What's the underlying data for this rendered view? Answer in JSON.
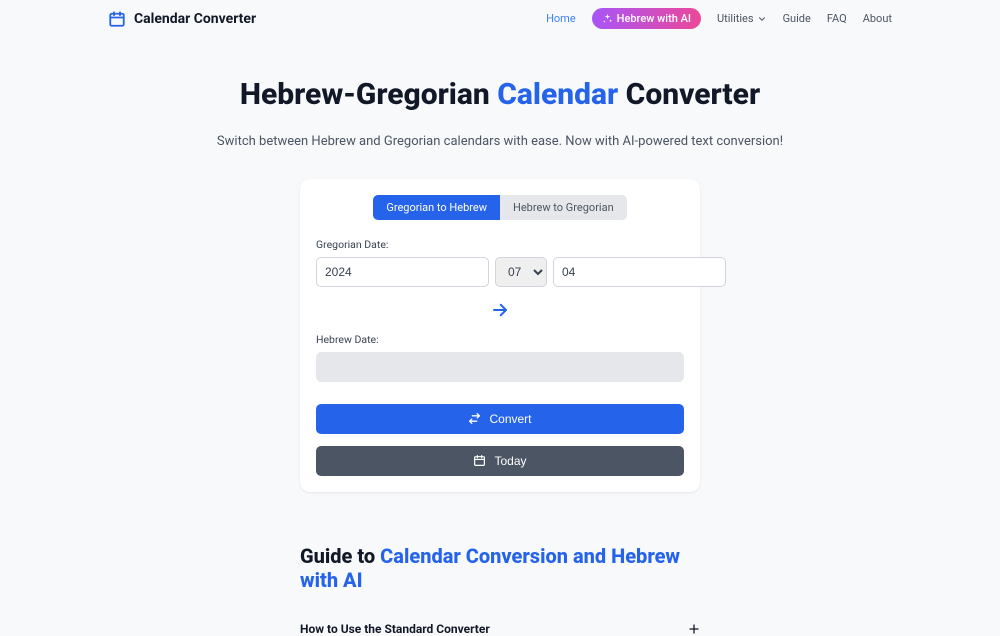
{
  "brand": {
    "title": "Calendar Converter"
  },
  "nav": {
    "home": "Home",
    "ai": "Hebrew with AI",
    "utilities": "Utilities",
    "guide": "Guide",
    "faq": "FAQ",
    "about": "About"
  },
  "hero": {
    "title_pre": "Hebrew-Gregorian ",
    "title_accent": "Calendar",
    "title_post": " Converter",
    "subtitle": "Switch between Hebrew and Gregorian calendars with ease. Now with AI-powered text conversion!"
  },
  "converter": {
    "tab_g2h": "Gregorian to Hebrew",
    "tab_h2g": "Hebrew to Gregorian",
    "gregorian_label": "Gregorian Date:",
    "year_value": "2024",
    "month_value": "07",
    "day_value": "04",
    "hebrew_label": "Hebrew Date:",
    "hebrew_value": "",
    "convert_label": "Convert",
    "today_label": "Today"
  },
  "guide": {
    "title_pre": "Guide to ",
    "title_accent": "Calendar Conversion and Hebrew with AI",
    "accordion1": "How to Use the Standard Converter"
  }
}
